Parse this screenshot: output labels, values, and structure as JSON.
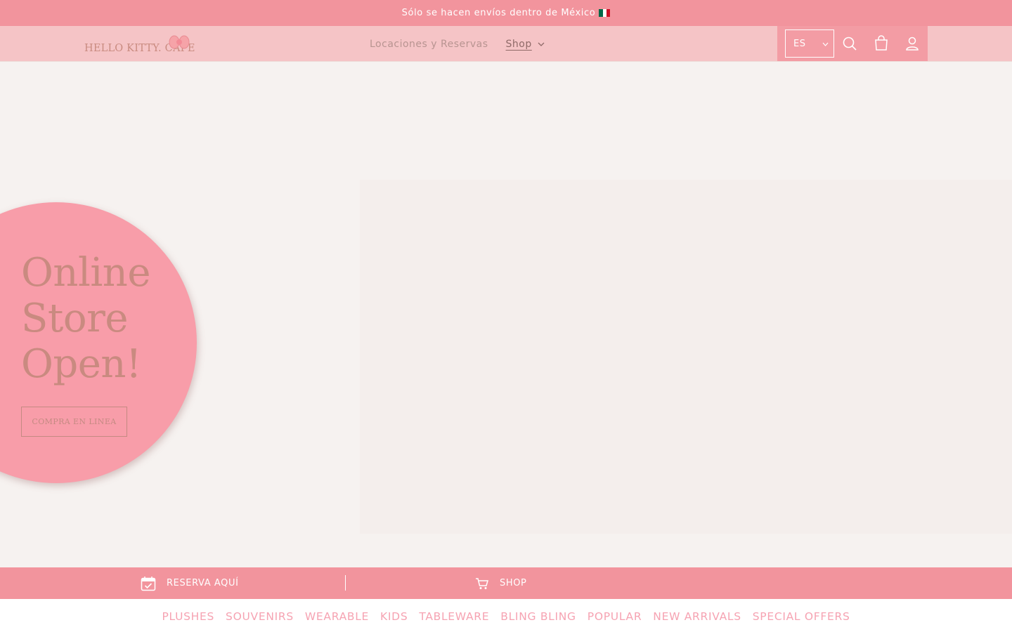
{
  "announcement": {
    "text": "Sólo se hacen envíos dentro de México",
    "flag_icon": "mexico-flag-icon",
    "flag_colors": [
      "#006847",
      "#ffffff",
      "#ce1126"
    ]
  },
  "header": {
    "logo_text": "HELLO KITTY. CAFE",
    "nav": {
      "locations_label": "Locaciones y Reservas",
      "shop_label": "Shop"
    },
    "language": {
      "selected": "ES"
    },
    "icons": [
      "search-icon",
      "cart-icon",
      "account-icon"
    ]
  },
  "hero": {
    "title_lines": [
      "Online",
      "Store",
      "Open!"
    ],
    "button_label": "COMPRA EN LINEA"
  },
  "bottom_bar": {
    "reserve_label": "RESERVA AQUÍ",
    "shop_label": "SHOP",
    "icons": [
      "calendar-check-icon",
      "cart-icon"
    ]
  },
  "categories": [
    "PLUSHES",
    "SOUVENIRS",
    "WEARABLE",
    "KIDS",
    "TABLEWARE",
    "BLING BLING",
    "POPULAR",
    "NEW ARRIVALS",
    "SPECIAL OFFERS"
  ],
  "colors": {
    "announcement_bg": "#f2949d",
    "header_bg": "#f5c4c6",
    "accent_pink": "#f89da9",
    "brand_brown": "#c98a80",
    "category_text": "#f6a3b2",
    "page_bg": "#f6f2f0"
  }
}
